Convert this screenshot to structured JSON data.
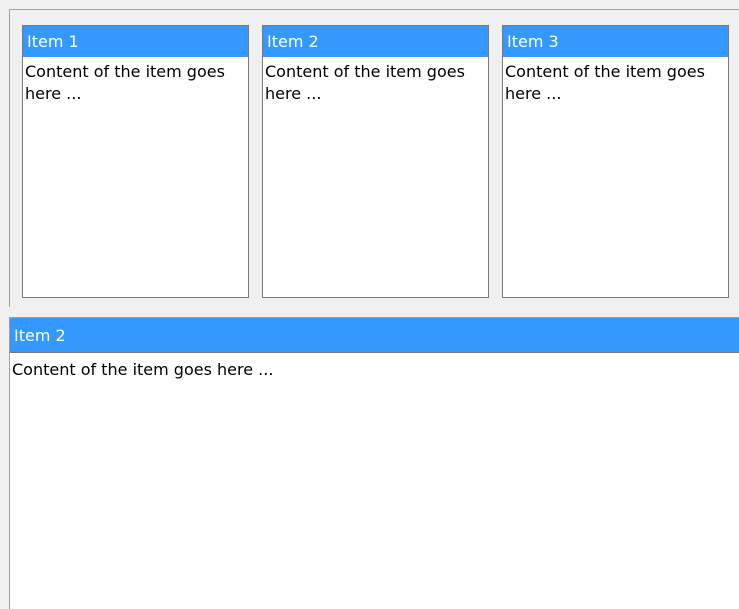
{
  "items": [
    {
      "title": "Item 1",
      "content": "Content of the item goes here ..."
    },
    {
      "title": "Item 2",
      "content": "Content of the item goes here ..."
    },
    {
      "title": "Item 3",
      "content": "Content of the item goes here ..."
    }
  ],
  "detail": {
    "title": "Item 2",
    "content": "Content of the item goes here ..."
  },
  "colors": {
    "header_background": "#3399ff",
    "header_text": "#ffffff",
    "panel_background": "#f0f0f0",
    "card_background": "#ffffff"
  }
}
